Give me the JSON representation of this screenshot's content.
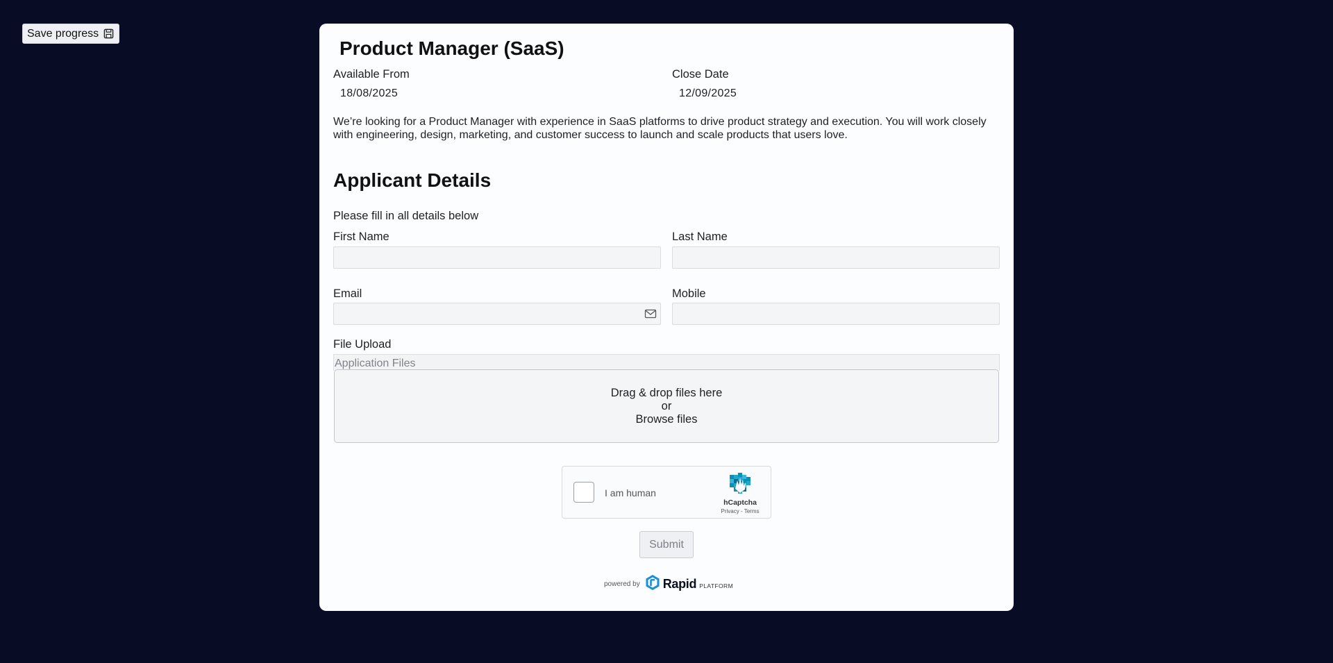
{
  "toolbar": {
    "save_label": "Save progress",
    "save_icon": "floppy-disk-icon"
  },
  "job": {
    "title": "Product Manager (SaaS)",
    "available_from_label": "Available From",
    "available_from_value": "18/08/2025",
    "close_date_label": "Close Date",
    "close_date_value": "12/09/2025",
    "description": "We’re looking for a Product Manager with experience in SaaS platforms to drive product strategy and execution. You will work closely with engineering, design, marketing, and customer success to launch and scale products that users love."
  },
  "applicant": {
    "section_title": "Applicant Details",
    "instructions": "Please fill in all details below",
    "first_name_label": "First Name",
    "first_name_value": "",
    "last_name_label": "Last Name",
    "last_name_value": "",
    "email_label": "Email",
    "email_value": "",
    "email_icon": "envelope-icon",
    "mobile_label": "Mobile",
    "mobile_value": ""
  },
  "upload": {
    "label": "File Upload",
    "subtitle": "Application Files",
    "drop_text": "Drag & drop files here",
    "or_text": "or",
    "browse_text": "Browse files"
  },
  "captcha": {
    "label": "I am human",
    "brand": "hCaptcha",
    "links": "Privacy - Terms",
    "checked": false
  },
  "form": {
    "submit_label": "Submit"
  },
  "footer": {
    "powered_by": "powered by",
    "brand_name": "Rapid",
    "brand_suffix": "PLATFORM",
    "colors": {
      "brand_blue": "#1a8fd6"
    }
  },
  "colors": {
    "page_background": "#080c24",
    "card_background": "#fcfdff",
    "field_background": "#f4f5f7"
  }
}
